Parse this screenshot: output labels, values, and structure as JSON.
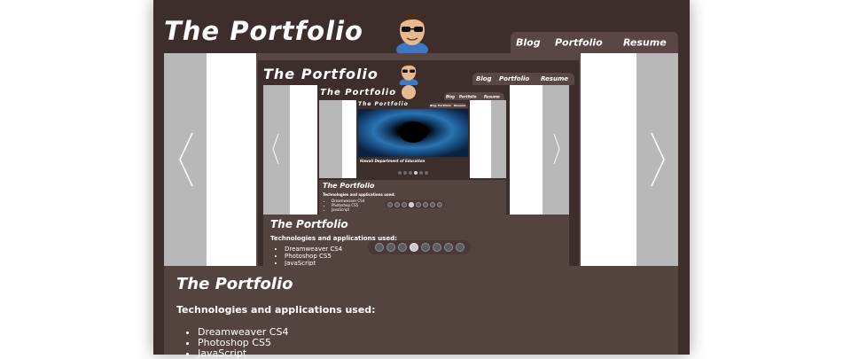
{
  "site": {
    "title": "The Portfolio",
    "nav": [
      "Blog",
      "Portfolio",
      "Resume"
    ]
  },
  "slider": {
    "dots_count": 8,
    "active_index": 3
  },
  "project": {
    "title": "The Portfolio",
    "tech_heading": "Technologies and applications used:",
    "tech_items": [
      "Dreamweaver CS4",
      "Photoshop CS5",
      "JavaScript"
    ]
  },
  "nested_project": {
    "title": "Hawaii Department of Education"
  },
  "icons": {
    "avatar": "cartoon-avatar-sunglasses-icon",
    "prev": "chevron-left-icon",
    "next": "chevron-right-icon"
  },
  "colors": {
    "page_bg": "#3d2d2b",
    "panel_bg": "#54443f",
    "nav_bg": "#5a4644",
    "gray_panel": "#b8b8b8"
  }
}
